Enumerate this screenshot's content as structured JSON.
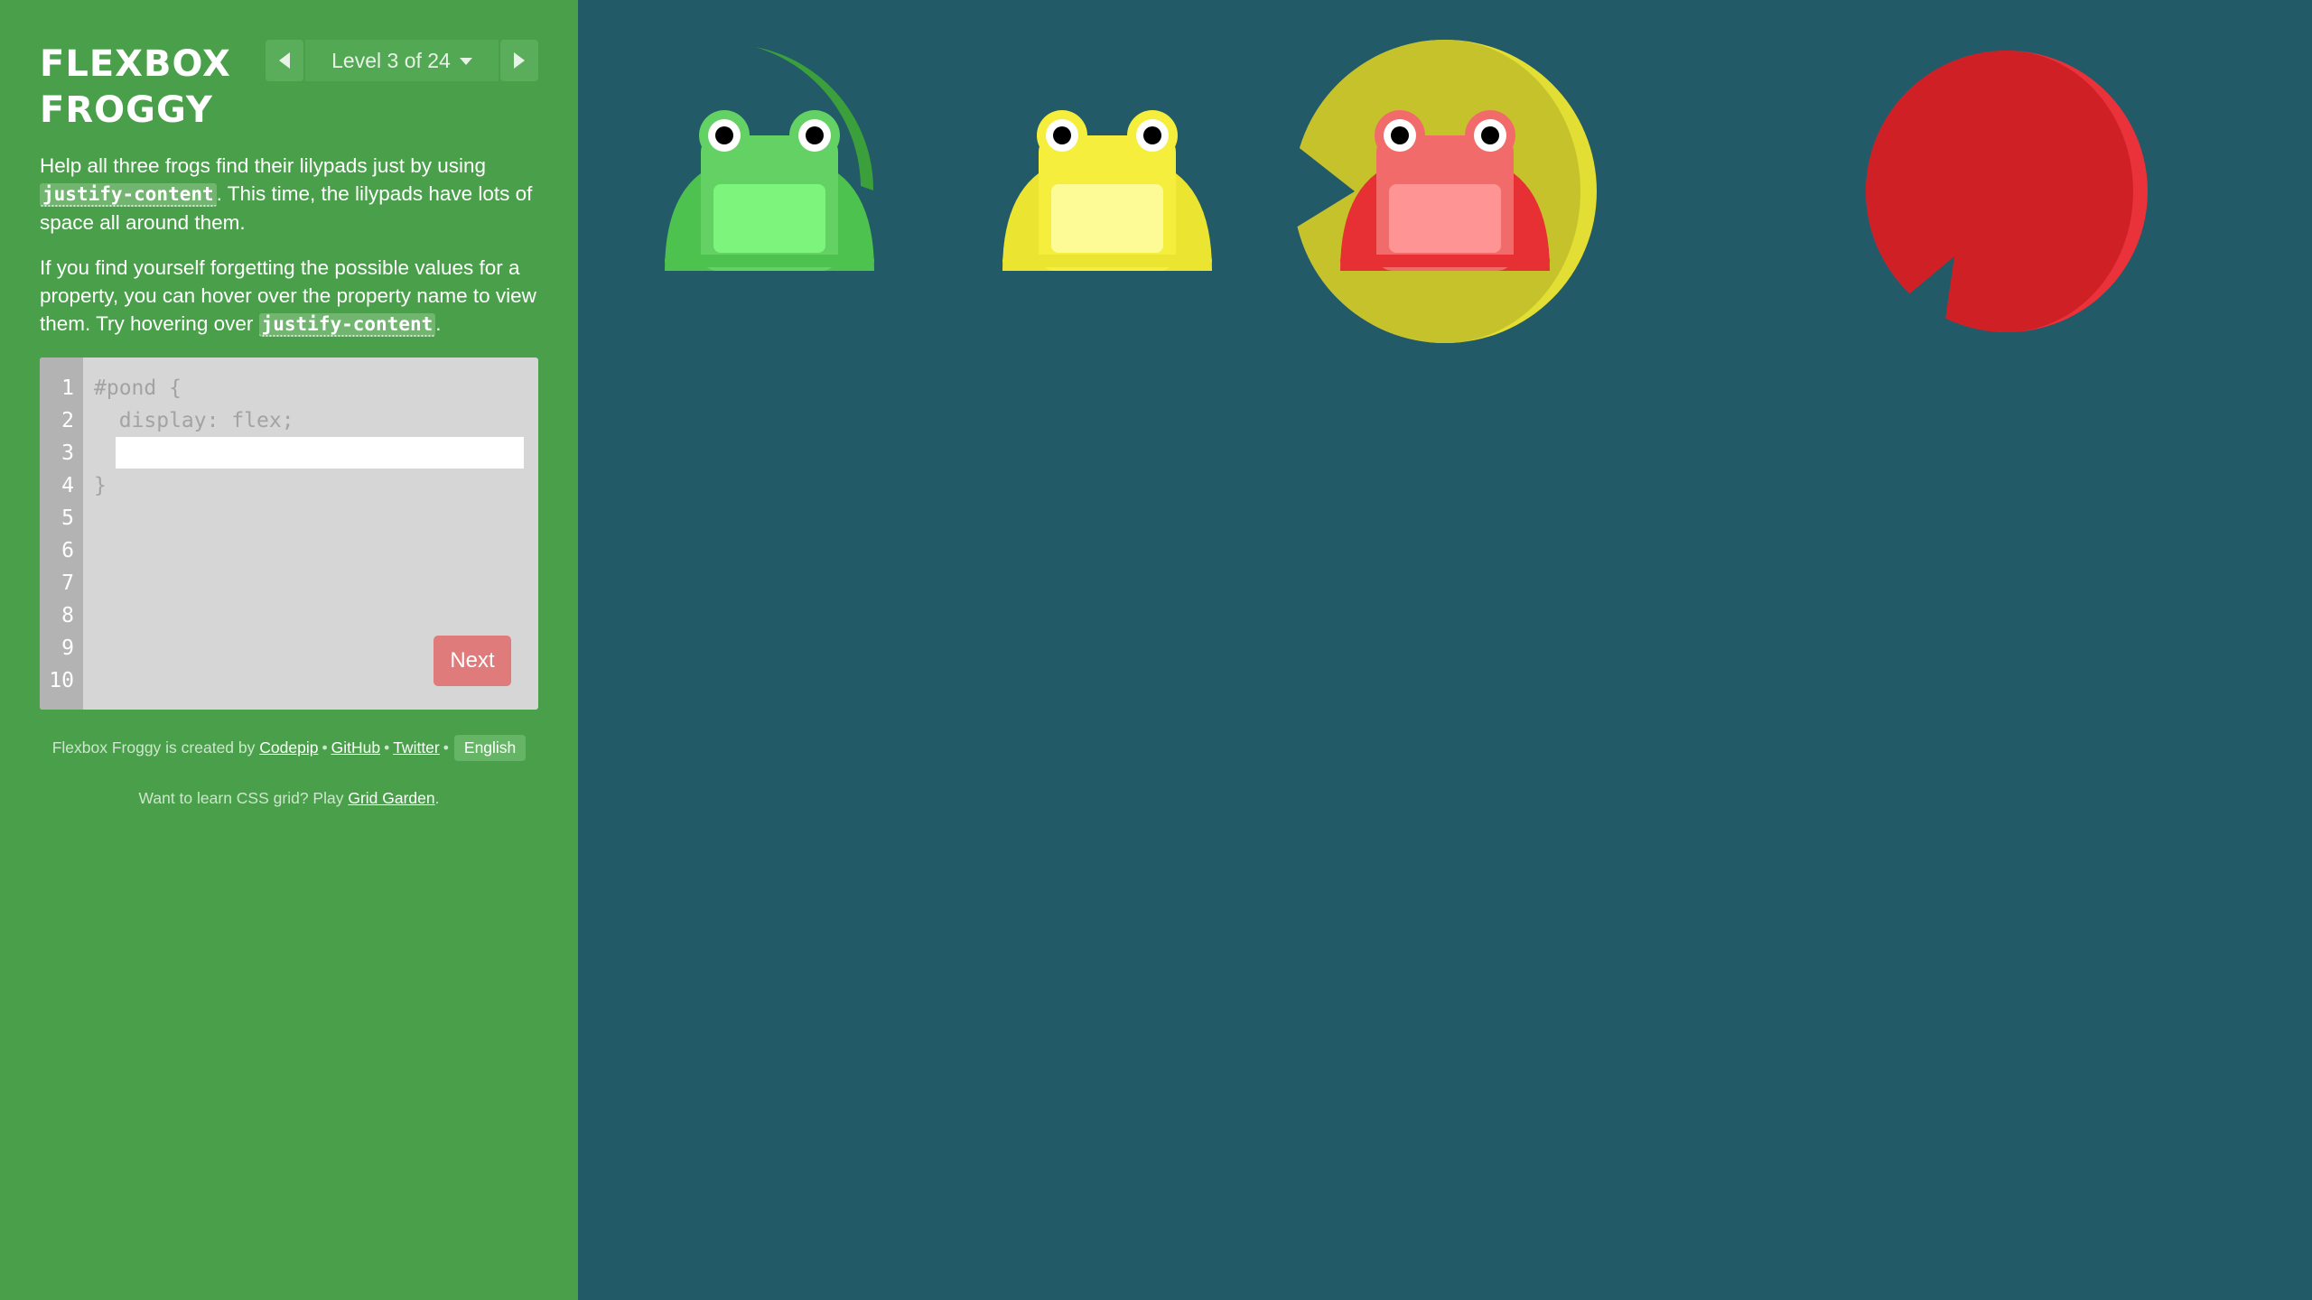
{
  "logo": {
    "line1": "FLEXBOX",
    "line2": "FROGGY"
  },
  "level": {
    "label": "Level 3 of 24"
  },
  "instructions": {
    "p1_before": "Help all three frogs find their lilypads just by using ",
    "p1_code": "justify-content",
    "p1_after": ". This time, the lilypads have lots of space all around them.",
    "p2_before": "If you find yourself forgetting the possible values for a property, you can hover over the property name to view them. Try hovering over ",
    "p2_code": "justify-content",
    "p2_after": "."
  },
  "editor": {
    "line_numbers": [
      "1",
      "2",
      "3",
      "4",
      "5",
      "6",
      "7",
      "8",
      "9",
      "10"
    ],
    "line1": "#pond {",
    "line2": "  display: flex;",
    "line4": "}",
    "input_value": "",
    "next_label": "Next"
  },
  "credits": {
    "prefix": "Flexbox Froggy is created by ",
    "codepip": "Codepip",
    "sep": "•",
    "github": "GitHub",
    "twitter": "Twitter",
    "language": "English"
  },
  "cta": {
    "prefix": "Want to learn CSS grid? Play ",
    "link": "Grid Garden",
    "suffix": "."
  },
  "colors": {
    "sidebar": "#4aa04a",
    "pond": "#235a68",
    "green_frog": "#63d163",
    "yellow_frog": "#f6ee3c",
    "red_frog": "#f26b6b",
    "green_pad": "#2e8a33",
    "yellow_pad": "#c6c22c",
    "red_pad": "#cf2026",
    "next_button": "#e07b7b"
  }
}
